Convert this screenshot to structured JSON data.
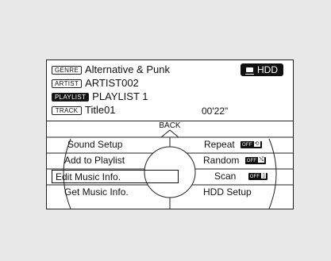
{
  "header": {
    "genre_tag": "GENRE",
    "genre": "Alternative & Punk",
    "artist_tag": "ARTIST",
    "artist": "ARTIST002",
    "playlist_tag": "PLAYLIST",
    "playlist": "PLAYLIST 1",
    "track_tag": "TRACK",
    "track": "Title01",
    "time": "00'22\"",
    "source": "HDD"
  },
  "back_label": "BACK",
  "menu": {
    "left": [
      {
        "label": "Sound Setup"
      },
      {
        "label": "Add to Playlist"
      },
      {
        "label": "Edit Music Info."
      },
      {
        "label": "Get Music Info."
      }
    ],
    "right": [
      {
        "label": "Repeat",
        "state": "OFF",
        "icon": "repeat-icon",
        "glyph": "⟲"
      },
      {
        "label": "Random",
        "state": "OFF",
        "icon": "shuffle-icon",
        "glyph": "⤭"
      },
      {
        "label": "Scan",
        "state": "OFF",
        "icon": "scan-icon",
        "glyph": "▯"
      },
      {
        "label": "HDD Setup"
      }
    ],
    "selected": "Edit Music Info."
  }
}
